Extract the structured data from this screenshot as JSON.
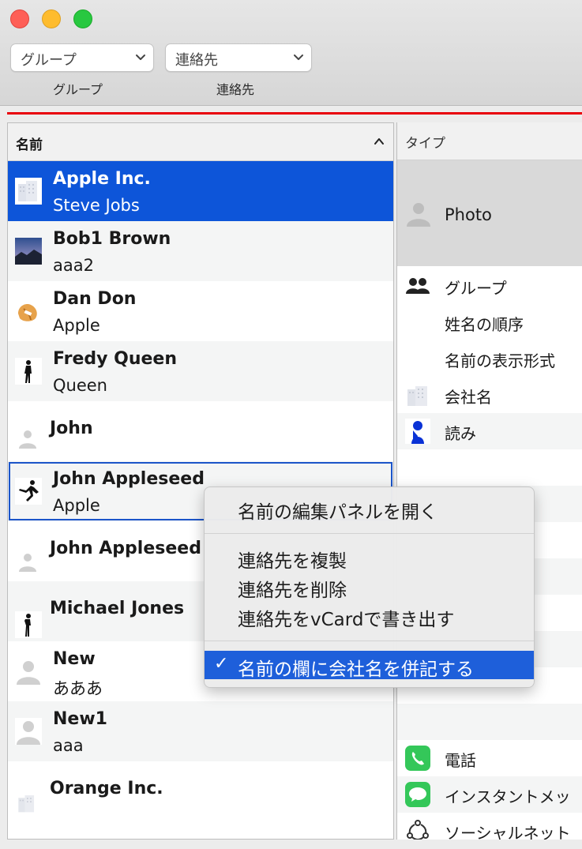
{
  "toolbar": {
    "group_popup_value": "グループ",
    "contact_popup_value": "連絡先",
    "group_label": "グループ",
    "contact_label": "連絡先"
  },
  "list": {
    "header": "名前",
    "rows": [
      {
        "name": "Apple Inc.",
        "sub": "Steve Jobs"
      },
      {
        "name": "Bob1 Brown",
        "sub": "aaa2"
      },
      {
        "name": "Dan Don",
        "sub": "Apple"
      },
      {
        "name": "Fredy Queen",
        "sub": "Queen"
      },
      {
        "name": "John",
        "sub": ""
      },
      {
        "name": "John Appleseed",
        "sub": "Apple"
      },
      {
        "name": "John Appleseed",
        "sub": ""
      },
      {
        "name": "Michael Jones",
        "sub": ""
      },
      {
        "name": "New",
        "sub": "あああ"
      },
      {
        "name": "New1",
        "sub": "aaa"
      },
      {
        "name": "Orange Inc.",
        "sub": ""
      }
    ]
  },
  "detail": {
    "header": "タイプ",
    "photo_label": "Photo",
    "rows": [
      "グループ",
      "姓名の順序",
      "名前の表示形式",
      "会社名",
      "読み",
      "電話",
      "インスタントメッ",
      "ソーシャルネット"
    ]
  },
  "menu": {
    "items": [
      "名前の編集パネルを開く",
      "連絡先を複製",
      "連絡先を削除",
      "連絡先をvCardで書き出す",
      "名前の欄に会社名を併記する"
    ],
    "check": "✓"
  },
  "colors": {
    "selection": "#0d55d9",
    "accent_line": "#e8000b",
    "menu_highlight": "#1e5fda"
  }
}
